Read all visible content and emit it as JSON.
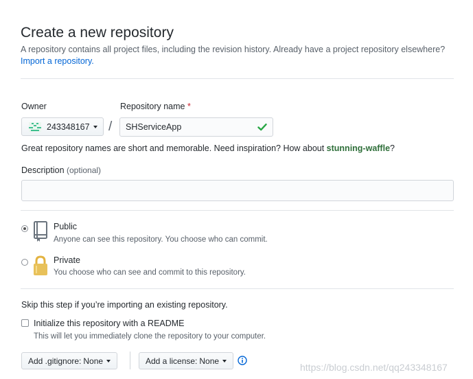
{
  "header": {
    "title": "Create a new repository",
    "subtitle": "A repository contains all project files, including the revision history. Already have a project repository elsewhere?",
    "import_link": "Import a repository."
  },
  "owner": {
    "label": "Owner",
    "value": "243348167"
  },
  "repo": {
    "label": "Repository name",
    "required_mark": "*",
    "value": "SHServiceApp",
    "separator": "/"
  },
  "hint": {
    "text": "Great repository names are short and memorable. Need inspiration? How about ",
    "suggestion": "stunning-waffle",
    "suffix": "?"
  },
  "description": {
    "label": "Description",
    "optional": "(optional)",
    "value": ""
  },
  "visibility": {
    "public": {
      "title": "Public",
      "note": "Anyone can see this repository. You choose who can commit.",
      "selected": true
    },
    "private": {
      "title": "Private",
      "note": "You choose who can see and commit to this repository.",
      "selected": false
    }
  },
  "init": {
    "skip_note": "Skip this step if you’re importing an existing repository.",
    "readme_label": "Initialize this repository with a README",
    "readme_note": "This will let you immediately clone the repository to your computer.",
    "checked": false
  },
  "buttons": {
    "gitignore_label": "Add .gitignore:",
    "gitignore_value": "None",
    "license_label": "Add a license:",
    "license_value": "None"
  },
  "watermark": "https://blog.csdn.net/qq243348167",
  "colors": {
    "link": "#0366d6",
    "check": "#28a745",
    "required": "#cb2431"
  },
  "icons": {
    "owner_avatar": "identicon",
    "repo_valid": "check-icon",
    "public": "repo-book-icon",
    "private": "lock-icon",
    "info": "info-icon"
  }
}
